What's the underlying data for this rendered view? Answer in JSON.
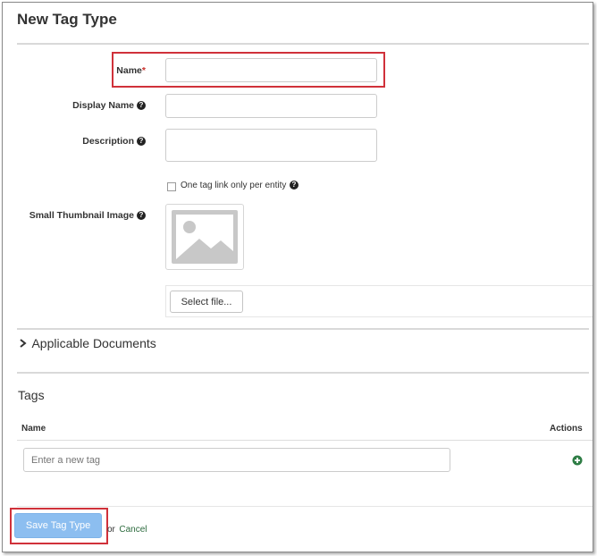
{
  "page": {
    "title": "New Tag Type"
  },
  "form": {
    "name_label": "Name",
    "required_mark": "*",
    "name_value": "",
    "display_name_label": "Display Name",
    "display_name_value": "",
    "description_label": "Description",
    "description_value": "",
    "one_tag_link_label": "One tag link only per entity",
    "one_tag_link_checked": false,
    "thumbnail_label": "Small Thumbnail Image",
    "select_file_label": "Select file..."
  },
  "applicable_documents": {
    "title": "Applicable Documents",
    "expanded": false
  },
  "tags": {
    "title": "Tags",
    "columns": [
      "Name",
      "Actions"
    ],
    "new_tag_placeholder": "Enter a new tag"
  },
  "footer": {
    "save_label": "Save Tag Type",
    "or_text": "or",
    "cancel_label": "Cancel"
  },
  "colors": {
    "highlight": "#d0313a",
    "primary_button": "#8cbef0",
    "add_icon": "#2e7d45",
    "link": "#2d6b3e"
  }
}
